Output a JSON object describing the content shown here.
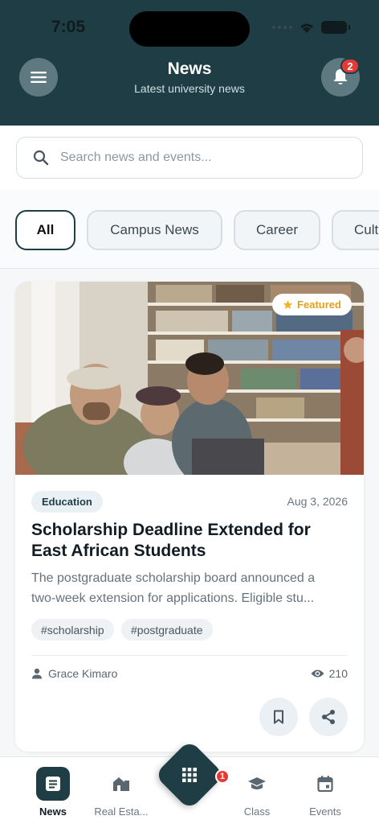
{
  "status": {
    "time": "7:05"
  },
  "header": {
    "title": "News",
    "subtitle": "Latest university news",
    "notification_count": "2"
  },
  "search": {
    "placeholder": "Search news and events..."
  },
  "filters": [
    "All",
    "Campus News",
    "Career",
    "Cult"
  ],
  "article": {
    "featured_label": "Featured",
    "category": "Education",
    "date": "Aug 3, 2026",
    "title": "Scholarship Deadline Extended for East African Students",
    "excerpt_line1": "The postgraduate scholarship board announced a",
    "excerpt_line2": "two-week extension for applications. Eligible stu...",
    "tags": [
      "#scholarship",
      "#postgraduate"
    ],
    "author": "Grace Kimaro",
    "views": "210"
  },
  "bottom_nav": {
    "items": [
      "News",
      "Real Esta...",
      "Class",
      "Events"
    ],
    "center_badge": "1"
  },
  "colors": {
    "primary": "#1e3d44",
    "badge": "#e53935",
    "featured": "#e0a21b"
  }
}
